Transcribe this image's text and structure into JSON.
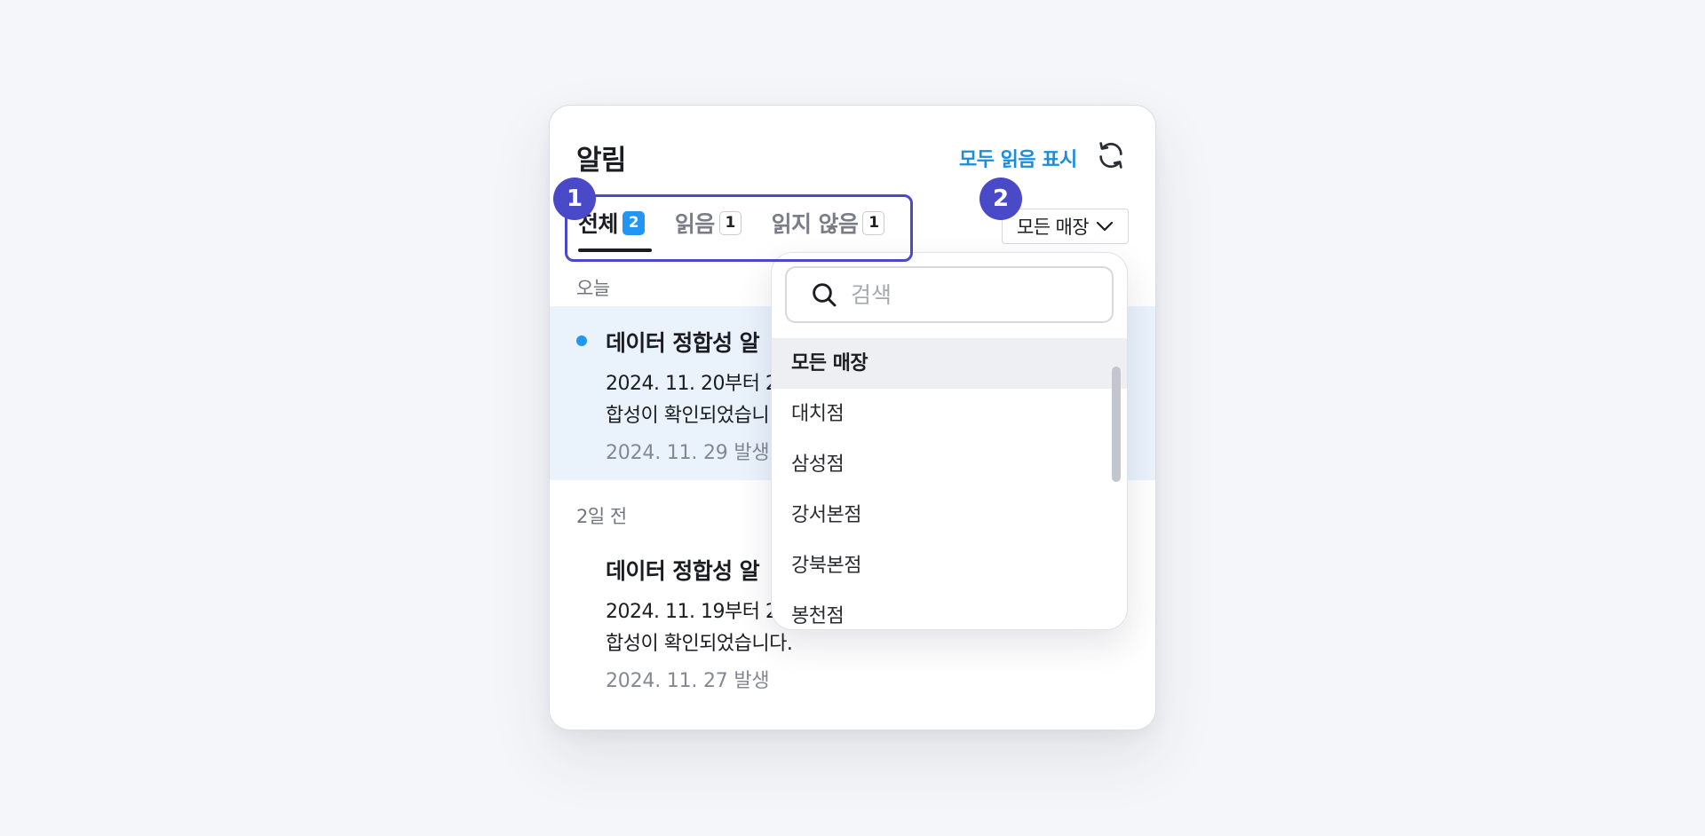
{
  "panel": {
    "title": "알림",
    "mark_all_read": "모두 읽음 표시",
    "refresh_icon": "refresh-icon"
  },
  "tabs": [
    {
      "label": "전체",
      "count": "2",
      "active": true
    },
    {
      "label": "읽음",
      "count": "1",
      "active": false
    },
    {
      "label": "읽지 않음",
      "count": "1",
      "active": false
    }
  ],
  "store_filter": {
    "selected": "모든 매장",
    "icon": "chevron-down-icon"
  },
  "groups": [
    {
      "label": "오늘"
    },
    {
      "label": "2일 전"
    }
  ],
  "notifications": [
    {
      "title": "데이터 정합성 알",
      "body_line1": "2024. 11. 20부터 2",
      "body_line2": "합성이 확인되었습니",
      "time": "2024. 11. 29 발생",
      "unread": true
    },
    {
      "title": "데이터 정합성 알",
      "body_line1": "2024. 11. 19부터 2",
      "body_line2": "합성이 확인되었습니다.",
      "time": "2024. 11. 27 발생",
      "unread": false
    }
  ],
  "dropdown": {
    "search_placeholder": "검색",
    "search_icon": "search-icon",
    "options": [
      "모든 매장",
      "대치점",
      "삼성점",
      "강서본점",
      "강북본점",
      "봉천점"
    ],
    "selected_index": 0
  },
  "annotations": {
    "marker_1": "1",
    "marker_2": "2"
  },
  "colors": {
    "accent": "#1a8de0",
    "badge_primary": "#2196f3",
    "unread_bg": "#eaf3fc",
    "annotation": "#4a4ac8"
  }
}
